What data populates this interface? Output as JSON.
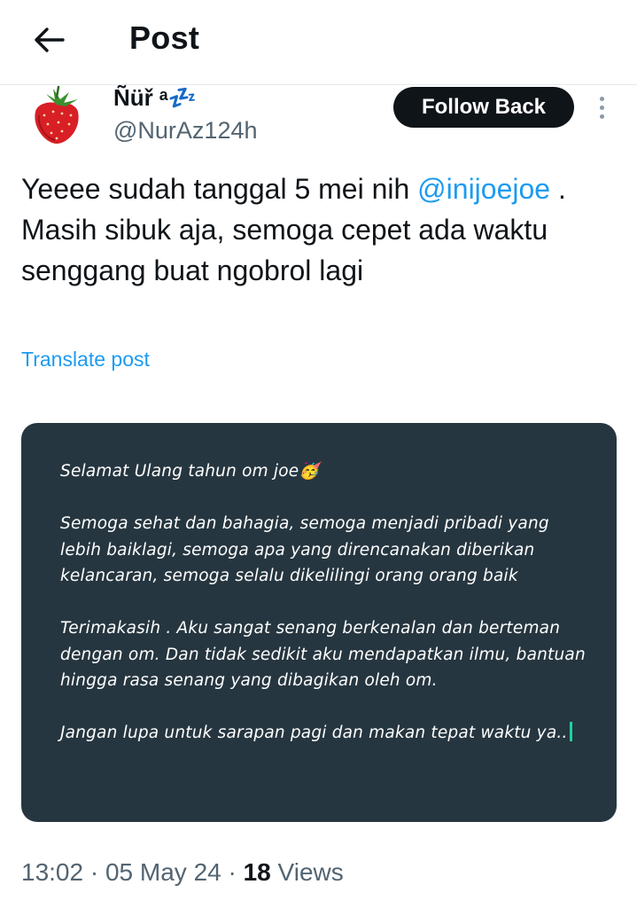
{
  "header": {
    "title": "Post",
    "back_icon": "arrow-left-icon"
  },
  "author": {
    "display_name": "Ñüř ᵃ💤",
    "handle": "@NurAz124h",
    "avatar_icon": "strawberry-avatar"
  },
  "follow_button": {
    "label": "Follow Back"
  },
  "more_icon": "more-vertical-icon",
  "tweet": {
    "text_before": "Yeeee sudah tanggal 5 mei nih ",
    "mention": "@inijoejoe",
    "text_after": " . Masih sibuk aja, semoga cepet ada waktu senggang buat ngobrol lagi",
    "translate_label": "Translate post"
  },
  "card": {
    "line1": "Selamat Ulang tahun om joe🥳",
    "para2": "Semoga sehat dan bahagia, semoga menjadi pribadi yang lebih baiklagi, semoga apa yang direncanakan diberikan kelancaran, semoga selalu dikelilingi orang orang baik",
    "para3": "Terimakasih . Aku sangat senang berkenalan dan berteman dengan om. Dan tidak sedikit aku mendapatkan ilmu, bantuan hingga rasa senang yang dibagikan oleh om.",
    "para4": "Jangan lupa untuk sarapan pagi dan makan tepat waktu ya..",
    "background": "#263640"
  },
  "meta": {
    "time": "13:02",
    "date": "05 May 24",
    "views_count": "18",
    "views_label": "Views"
  }
}
